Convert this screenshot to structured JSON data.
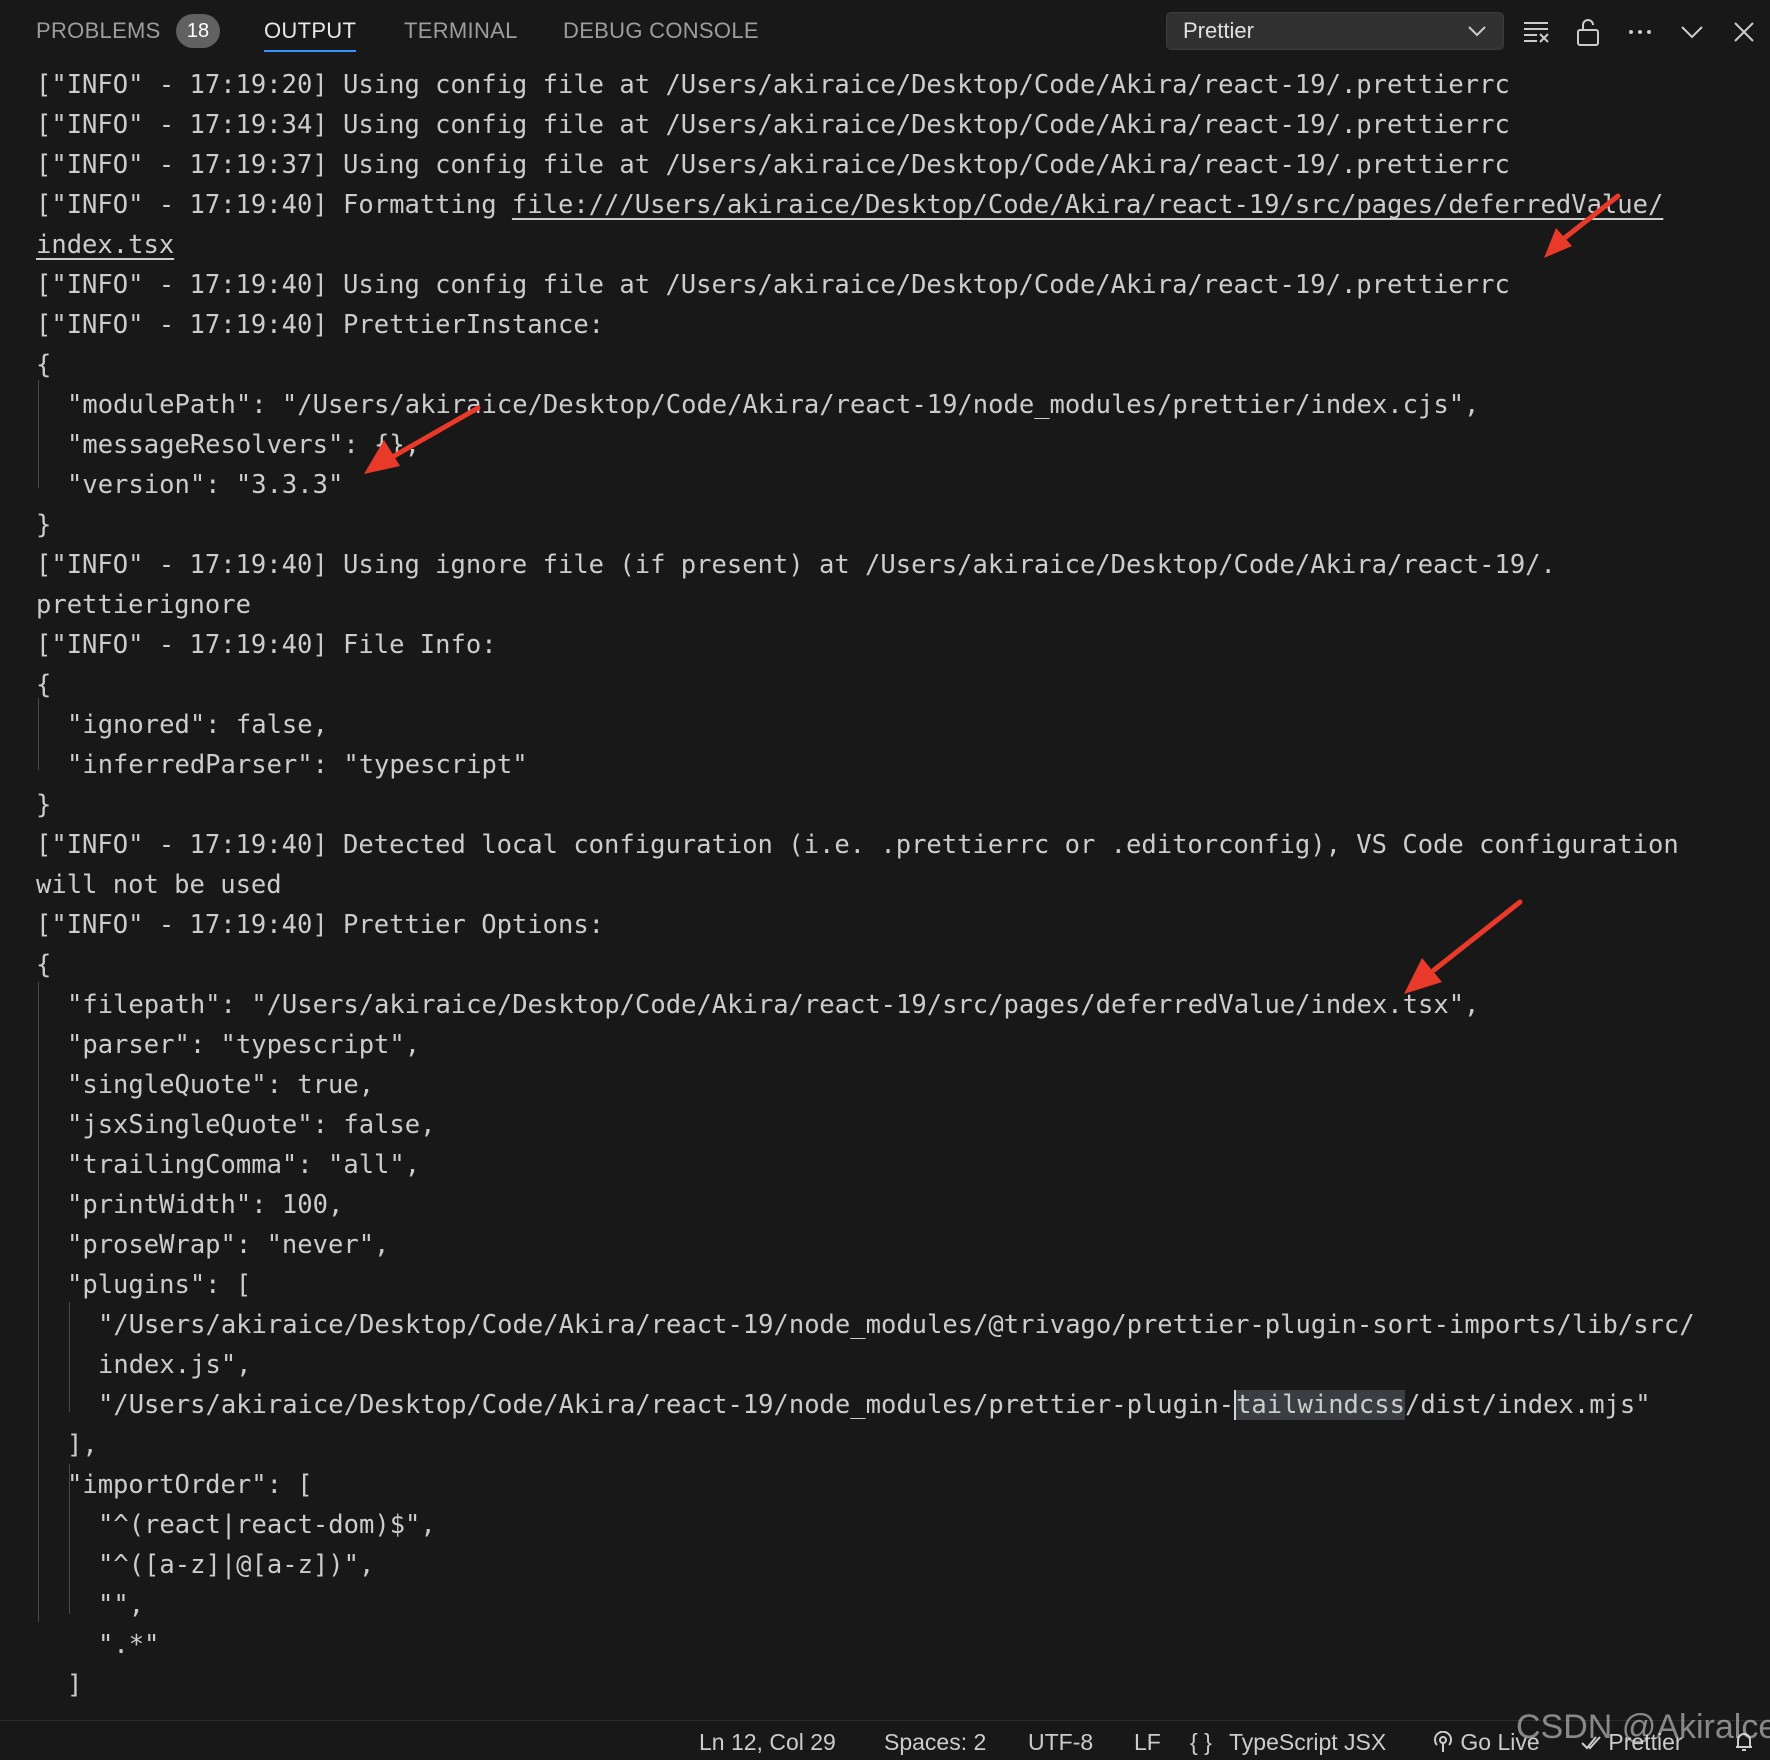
{
  "tabs": {
    "problems": "PROBLEMS",
    "problems_count": "18",
    "output": "OUTPUT",
    "terminal": "TERMINAL",
    "debug_console": "DEBUG CONSOLE"
  },
  "channel_select": {
    "value": "Prettier"
  },
  "icons": {
    "clear": "clear-output-icon",
    "lock": "lock-scroll-icon",
    "more": "more-actions-icon",
    "collapse": "chevron-down-icon",
    "close": "close-icon"
  },
  "log": {
    "l01": "[\"INFO\" - 17:19:20] Using config file at /Users/akiraice/Desktop/Code/Akira/react-19/.prettierrc",
    "l02": "[\"INFO\" - 17:19:34] Using config file at /Users/akiraice/Desktop/Code/Akira/react-19/.prettierrc",
    "l03": "[\"INFO\" - 17:19:37] Using config file at /Users/akiraice/Desktop/Code/Akira/react-19/.prettierrc",
    "l04_prefix": "[\"INFO\" - 17:19:40] Formatting ",
    "l04_link": "file:///Users/akiraice/Desktop/Code/Akira/react-19/src/pages/deferredValue/",
    "l05_link": "index.tsx",
    "l06": "[\"INFO\" - 17:19:40] Using config file at /Users/akiraice/Desktop/Code/Akira/react-19/.prettierrc",
    "l07": "[\"INFO\" - 17:19:40] PrettierInstance:",
    "l08": "{",
    "l09": "\"modulePath\": \"/Users/akiraice/Desktop/Code/Akira/react-19/node_modules/prettier/index.cjs\",",
    "l10": "\"messageResolvers\": {},",
    "l11": "\"version\": \"3.3.3\"",
    "l12": "}",
    "l13": "[\"INFO\" - 17:19:40] Using ignore file (if present) at /Users/akiraice/Desktop/Code/Akira/react-19/.",
    "l14": "prettierignore",
    "l15": "[\"INFO\" - 17:19:40] File Info:",
    "l16": "{",
    "l17": "\"ignored\": false,",
    "l18": "\"inferredParser\": \"typescript\"",
    "l19": "}",
    "l20": "[\"INFO\" - 17:19:40] Detected local configuration (i.e. .prettierrc or .editorconfig), VS Code configuration",
    "l21": "will not be used",
    "l22": "[\"INFO\" - 17:19:40] Prettier Options:",
    "l23": "{",
    "l24": "\"filepath\": \"/Users/akiraice/Desktop/Code/Akira/react-19/src/pages/deferredValue/index.tsx\",",
    "l25": "\"parser\": \"typescript\",",
    "l26": "\"singleQuote\": true,",
    "l27": "\"jsxSingleQuote\": false,",
    "l28": "\"trailingComma\": \"all\",",
    "l29": "\"printWidth\": 100,",
    "l30": "\"proseWrap\": \"never\",",
    "l31": "\"plugins\": [",
    "l32": "\"/Users/akiraice/Desktop/Code/Akira/react-19/node_modules/@trivago/prettier-plugin-sort-imports/lib/src/",
    "l33": "index.js\",",
    "l34_a": "\"/Users/akiraice/Desktop/Code/Akira/react-19/node_modules/prettier-plugin-",
    "l34_hl": "tailwindcss",
    "l34_b": "/dist/index.mjs\"",
    "l35": "],",
    "l36": "\"importOrder\": [",
    "l37": "\"^(react|react-dom)$\",",
    "l38": "\"^([a-z]|@[a-z])\",",
    "l39": "\"\",",
    "l40": "\".*\"",
    "l41": "]"
  },
  "statusbar": {
    "position": "Ln 12, Col 29",
    "spaces": "Spaces: 2",
    "encoding": "UTF-8",
    "eol": "LF",
    "language_glyph": "{ }",
    "language": "TypeScript JSX",
    "golive": "Go Live",
    "prettier": "Prettier"
  },
  "watermark": "CSDN @Akiralce",
  "colors": {
    "background": "#181818",
    "text": "#cccccc",
    "active_tab_underline": "#3794ff",
    "annotation_arrow": "#e8392b"
  }
}
